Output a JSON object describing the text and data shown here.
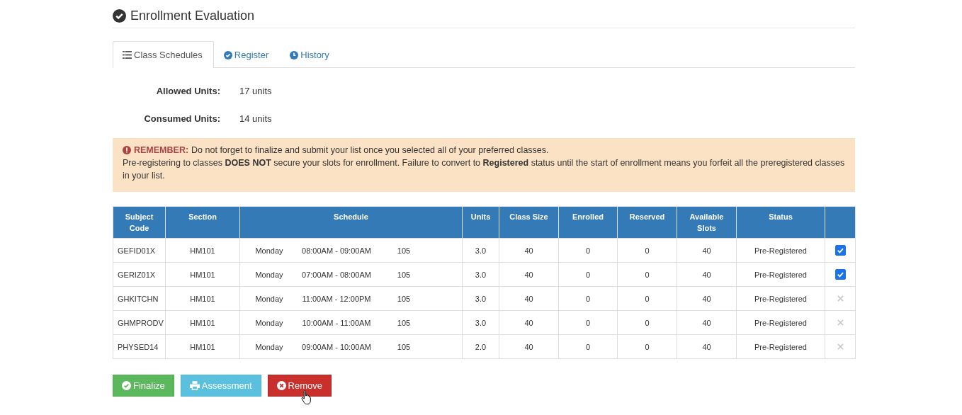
{
  "page_title": "Enrollment Evaluation",
  "tabs": [
    {
      "label": "Class Schedules",
      "kind": "list",
      "selected": true
    },
    {
      "label": "Register",
      "kind": "check",
      "selected": false
    },
    {
      "label": "History",
      "kind": "clock",
      "selected": false
    }
  ],
  "summary": [
    {
      "label": "Allowed Units:",
      "value": "17 units"
    },
    {
      "label": "Consumed Units:",
      "value": "14 units"
    }
  ],
  "alert": {
    "label": "REMEMBER:",
    "message": "Do not forget to finalize and submit your list once you selected all of your preferred classes.",
    "note": "Pre-registering to classes **DOES NOT** secure your slots for enrollment. Failure to convert to **Registered** status until the start of enrollment means you forfeit all the preregistered classes in your list."
  },
  "table": {
    "columns": [
      "Subject Code",
      "Section",
      "Schedule",
      "Units",
      "Class Size",
      "Enrolled",
      "Reserved",
      "Available Slots",
      "Status"
    ],
    "rows": [
      {
        "code": "GEFID01X",
        "section": "HM101",
        "day": "Monday",
        "time": "08:00AM - 09:00AM",
        "room": "105",
        "units": "3.0",
        "class_size": "40",
        "enrolled": "0",
        "reserved": "0",
        "available": "40",
        "status": "Pre-Registered",
        "kind": "checkbox",
        "checked": true
      },
      {
        "code": "GERIZ01X",
        "section": "HM101",
        "day": "Monday",
        "time": "07:00AM - 08:00AM",
        "room": "105",
        "units": "3.0",
        "class_size": "40",
        "enrolled": "0",
        "reserved": "0",
        "available": "40",
        "status": "Pre-Registered",
        "kind": "checkbox",
        "checked": true
      },
      {
        "code": "GHKITCHN",
        "section": "HM101",
        "day": "Monday",
        "time": "11:00AM - 12:00PM",
        "room": "105",
        "units": "3.0",
        "class_size": "40",
        "enrolled": "0",
        "reserved": "0",
        "available": "40",
        "status": "Pre-Registered",
        "kind": "cross"
      },
      {
        "code": "GHMPRODV",
        "section": "HM101",
        "day": "Monday",
        "time": "10:00AM - 11:00AM",
        "room": "105",
        "units": "3.0",
        "class_size": "40",
        "enrolled": "0",
        "reserved": "0",
        "available": "40",
        "status": "Pre-Registered",
        "kind": "cross"
      },
      {
        "code": "PHYSED14",
        "section": "HM101",
        "day": "Monday",
        "time": "09:00AM - 10:00AM",
        "room": "105",
        "units": "2.0",
        "class_size": "40",
        "enrolled": "0",
        "reserved": "0",
        "available": "40",
        "status": "Pre-Registered",
        "kind": "cross"
      }
    ]
  },
  "buttons": [
    {
      "label": "Finalize",
      "kind": "success"
    },
    {
      "label": "Assessment",
      "kind": "info"
    },
    {
      "label": "Remove",
      "kind": "danger"
    }
  ]
}
